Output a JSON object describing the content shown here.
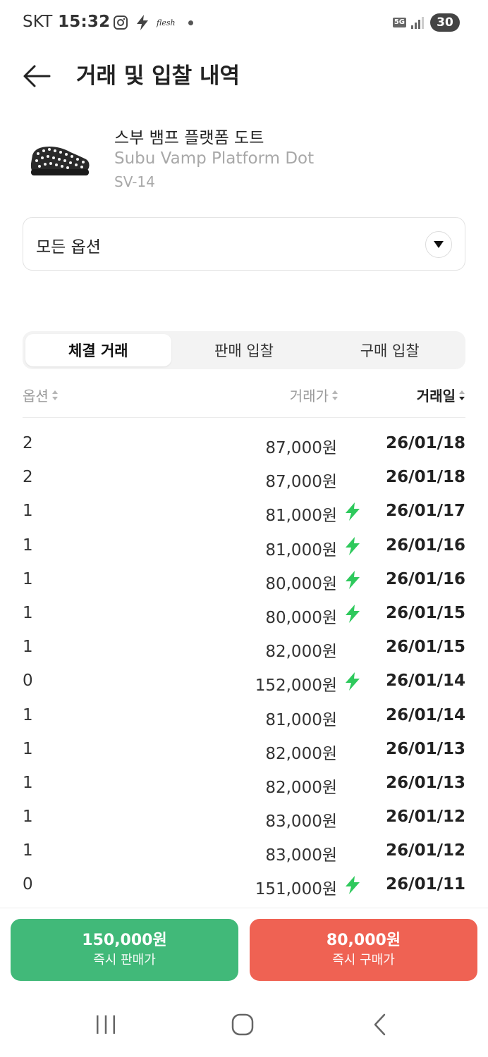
{
  "status_bar": {
    "carrier": "SKT",
    "time": "15:32",
    "notification_text": "flesh",
    "network": "5G",
    "battery": "30",
    "icons": [
      "instagram-icon",
      "bolt-icon",
      "app-notification-icon",
      "dot-icon",
      "signal-icon",
      "battery-icon"
    ]
  },
  "header": {
    "title": "거래 및 입찰 내역",
    "back_icon": "arrow-left-icon"
  },
  "product": {
    "name_ko": "스부 뱀프 플랫폼 도트",
    "name_en": "Subu Vamp Platform Dot",
    "model": "SV-14"
  },
  "option_select": {
    "value": "모든 옵션",
    "icon": "chevron-down-icon"
  },
  "tabs": [
    {
      "label": "체결 거래",
      "active": true
    },
    {
      "label": "판매 입찰",
      "active": false
    },
    {
      "label": "구매 입찰",
      "active": false
    }
  ],
  "table": {
    "headers": {
      "option": "옵션",
      "price": "거래가",
      "date": "거래일"
    },
    "rows": [
      {
        "option": "2",
        "price": "87,000원",
        "fast": false,
        "date": "26/01/18"
      },
      {
        "option": "2",
        "price": "87,000원",
        "fast": false,
        "date": "26/01/18"
      },
      {
        "option": "1",
        "price": "81,000원",
        "fast": true,
        "date": "26/01/17"
      },
      {
        "option": "1",
        "price": "81,000원",
        "fast": true,
        "date": "26/01/16"
      },
      {
        "option": "1",
        "price": "80,000원",
        "fast": true,
        "date": "26/01/16"
      },
      {
        "option": "1",
        "price": "80,000원",
        "fast": true,
        "date": "26/01/15"
      },
      {
        "option": "1",
        "price": "82,000원",
        "fast": false,
        "date": "26/01/15"
      },
      {
        "option": "0",
        "price": "152,000원",
        "fast": true,
        "date": "26/01/14"
      },
      {
        "option": "1",
        "price": "81,000원",
        "fast": false,
        "date": "26/01/14"
      },
      {
        "option": "1",
        "price": "82,000원",
        "fast": false,
        "date": "26/01/13"
      },
      {
        "option": "1",
        "price": "82,000원",
        "fast": false,
        "date": "26/01/13"
      },
      {
        "option": "1",
        "price": "83,000원",
        "fast": false,
        "date": "26/01/12"
      },
      {
        "option": "1",
        "price": "83,000원",
        "fast": false,
        "date": "26/01/12"
      },
      {
        "option": "0",
        "price": "151,000원",
        "fast": true,
        "date": "26/01/11"
      }
    ]
  },
  "buttons": {
    "sell": {
      "price": "150,000원",
      "label": "즉시 판매가",
      "color": "#41b979"
    },
    "buy": {
      "price": "80,000원",
      "label": "즉시 구매가",
      "color": "#ef6253"
    }
  },
  "colors": {
    "fast_bolt": "#2ec95c",
    "text_primary": "#222222",
    "text_muted": "#a8a8a8"
  },
  "nav": {
    "icons": [
      "recent-apps-icon",
      "home-icon",
      "back-icon"
    ]
  }
}
